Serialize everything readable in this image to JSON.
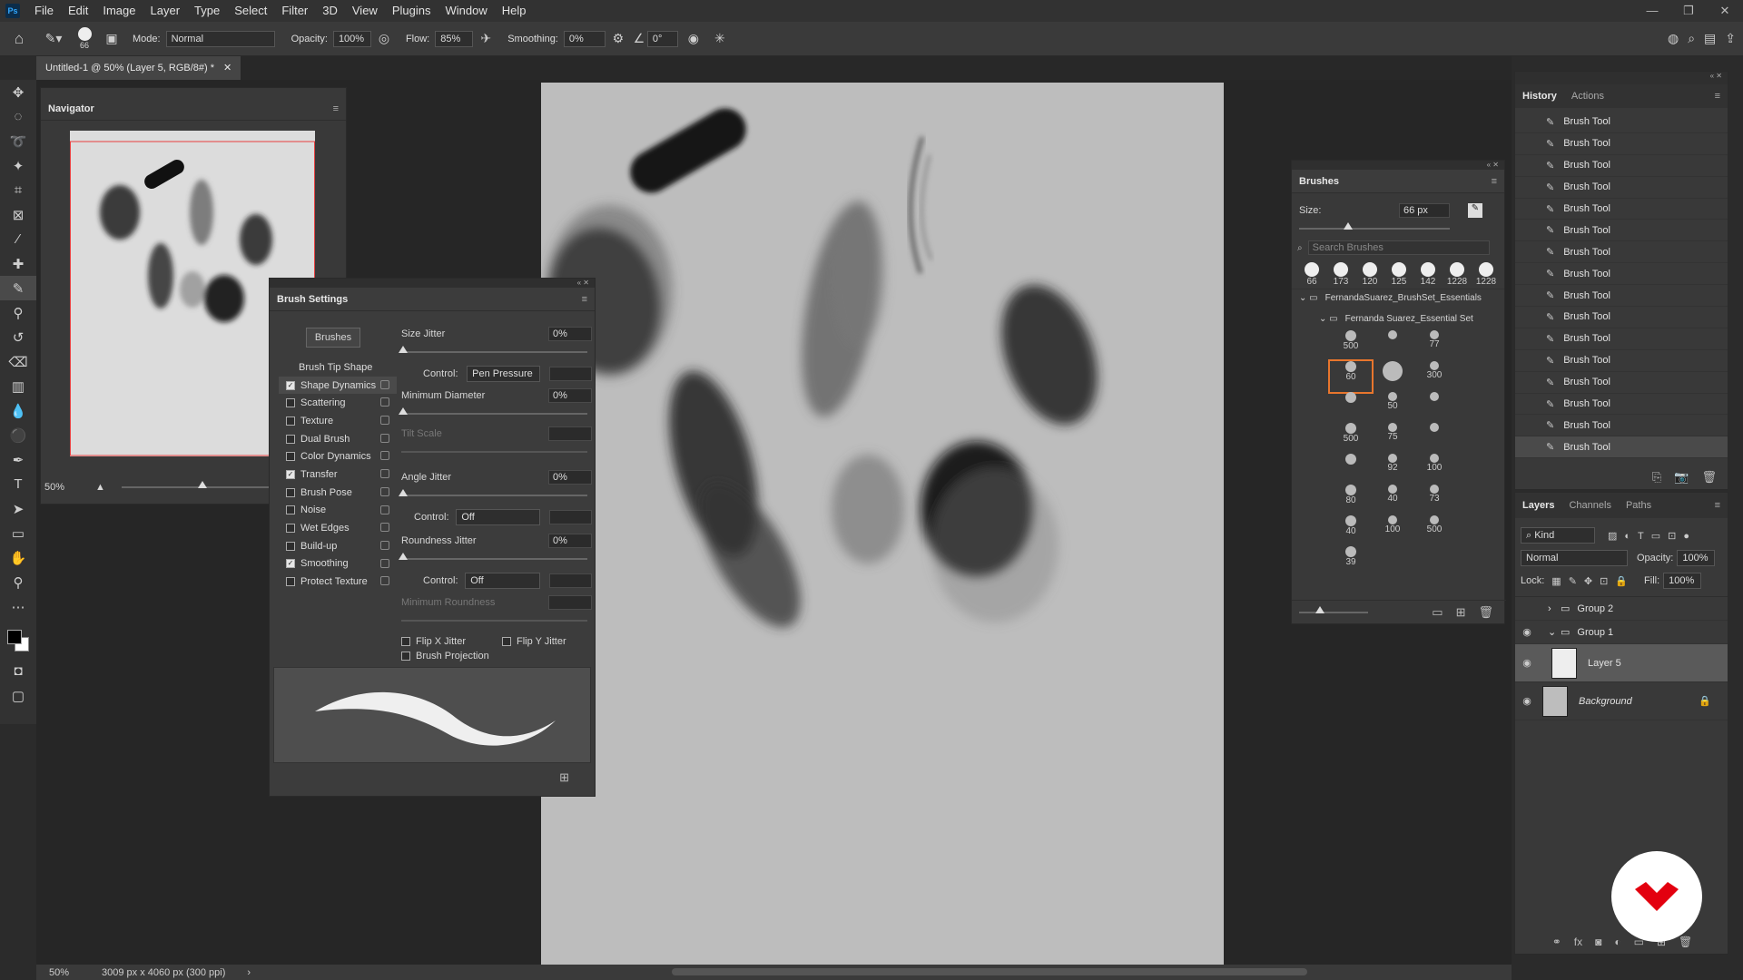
{
  "app": {
    "logo": "Ps",
    "menus": [
      "File",
      "Edit",
      "Image",
      "Layer",
      "Type",
      "Select",
      "Filter",
      "3D",
      "View",
      "Plugins",
      "Window",
      "Help"
    ],
    "window_controls": [
      "minimize-icon",
      "restore-icon",
      "close-icon"
    ]
  },
  "options": {
    "brush_size": "66",
    "mode_label": "Mode:",
    "mode": "Normal",
    "opacity_label": "Opacity:",
    "opacity": "100%",
    "flow_label": "Flow:",
    "flow": "85%",
    "smoothing_label": "Smoothing:",
    "smoothing": "0%",
    "angle": "0°"
  },
  "document": {
    "tab": "Untitled-1 @ 50% (Layer 5, RGB/8#) *",
    "zoom": "50%",
    "info": "3009 px x 4060 px (300 ppi)"
  },
  "navigator": {
    "title": "Navigator",
    "zoom": "50%"
  },
  "brush_settings": {
    "title": "Brush Settings",
    "brushes_button": "Brushes",
    "tip_shape": "Brush Tip Shape",
    "items": [
      {
        "label": "Shape Dynamics",
        "checked": true,
        "active": true
      },
      {
        "label": "Scattering",
        "checked": false
      },
      {
        "label": "Texture",
        "checked": false
      },
      {
        "label": "Dual Brush",
        "checked": false
      },
      {
        "label": "Color Dynamics",
        "checked": false
      },
      {
        "label": "Transfer",
        "checked": true
      },
      {
        "label": "Brush Pose",
        "checked": false
      },
      {
        "label": "Noise",
        "checked": false
      },
      {
        "label": "Wet Edges",
        "checked": false
      },
      {
        "label": "Build-up",
        "checked": false
      },
      {
        "label": "Smoothing",
        "checked": true
      },
      {
        "label": "Protect Texture",
        "checked": false
      }
    ],
    "size_jitter": {
      "label": "Size Jitter",
      "value": "0%"
    },
    "control1": {
      "label": "Control:",
      "value": "Pen Pressure"
    },
    "min_diameter": {
      "label": "Minimum Diameter",
      "value": "0%"
    },
    "tilt_scale": "Tilt Scale",
    "angle_jitter": {
      "label": "Angle Jitter",
      "value": "0%"
    },
    "control2": {
      "label": "Control:",
      "value": "Off"
    },
    "roundness_jitter": {
      "label": "Roundness Jitter",
      "value": "0%"
    },
    "control3": {
      "label": "Control:",
      "value": "Off"
    },
    "min_roundness": "Minimum Roundness",
    "flip_x": "Flip X Jitter",
    "flip_y": "Flip Y Jitter",
    "projection": "Brush Projection"
  },
  "brushes": {
    "title": "Brushes",
    "size_label": "Size:",
    "size": "66 px",
    "search_placeholder": "Search Brushes",
    "recent": [
      "66",
      "173",
      "120",
      "125",
      "142",
      "1228",
      "1228"
    ],
    "folder1": "FernandaSuarez_BrushSet_Essentials",
    "folder2": "Fernanda Suarez_Essential Set",
    "grid": [
      "500",
      "",
      "77",
      "60",
      "",
      "300",
      "",
      "50",
      "",
      "500",
      "75",
      "",
      "",
      "92",
      "100",
      "80",
      "40",
      "73",
      "40",
      "100",
      "500",
      "39"
    ]
  },
  "history": {
    "tabs": [
      "History",
      "Actions"
    ],
    "items": [
      "Brush Tool",
      "Brush Tool",
      "Brush Tool",
      "Brush Tool",
      "Brush Tool",
      "Brush Tool",
      "Brush Tool",
      "Brush Tool",
      "Brush Tool",
      "Brush Tool",
      "Brush Tool",
      "Brush Tool",
      "Brush Tool",
      "Brush Tool",
      "Brush Tool",
      "Brush Tool"
    ]
  },
  "layers": {
    "tabs": [
      "Layers",
      "Channels",
      "Paths"
    ],
    "kind": "Kind",
    "blend": "Normal",
    "opacity_label": "Opacity:",
    "opacity": "100%",
    "lock_label": "Lock:",
    "fill_label": "Fill:",
    "fill": "100%",
    "rows": [
      {
        "name": "Group 2",
        "type": "group",
        "visible": false,
        "expanded": false
      },
      {
        "name": "Group 1",
        "type": "group",
        "visible": true,
        "expanded": true
      },
      {
        "name": "Layer 5",
        "type": "layer",
        "visible": true,
        "selected": true
      },
      {
        "name": "Background",
        "type": "background",
        "visible": true,
        "locked": true
      }
    ]
  },
  "colors": {
    "accent": "#e8762d",
    "brand": "#e3000f"
  }
}
